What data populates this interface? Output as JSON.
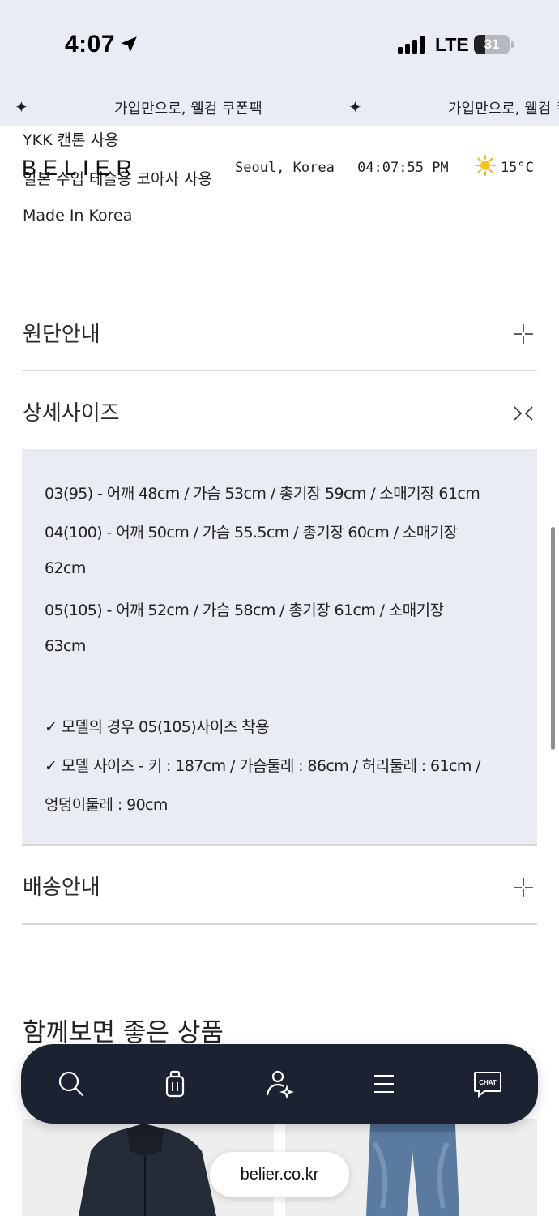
{
  "status_bar": {
    "time": "4:07",
    "network": "LTE",
    "battery": "31",
    "battery_level": 0.31
  },
  "banner": {
    "text": "가입만으로, 웰컴 쿠폰팩",
    "text_partial": "가입만으로, 웰컴 쿠",
    "star": "✦"
  },
  "header": {
    "logo": "BELIER",
    "location": "Seoul, Korea",
    "clock": "04:07:55 PM",
    "weather_icon": "sun-icon",
    "temperature": "15°C"
  },
  "spec_lines": [
    "YKK 캔톤 사용",
    "일본 수입 테슬용 코아사 사용",
    "Made In Korea"
  ],
  "accordion": {
    "fabric_title": "원단안내",
    "size_title": "상세사이즈",
    "shipping_title": "배송안내",
    "size_lines": [
      "03(95) - 어깨 48cm / 가슴 53cm / 총기장 59cm / 소매기장 61cm",
      "04(100) - 어깨 50cm / 가슴 55.5cm / 총기장 60cm / 소매기장",
      "62cm",
      "05(105) - 어깨 52cm / 가슴 58cm / 총기장 61cm / 소매기장",
      "63cm",
      "✓ 모델의 경우 05(105)사이즈 착용",
      "✓ 모델 사이즈 - 키 : 187cm / 가슴둘레 : 86cm / 허리둘레 : 61cm /",
      "엉덩이둘레 : 90cm"
    ]
  },
  "recommend": {
    "title": "함께보면 좋은 상품"
  },
  "bottom_nav": {
    "items": [
      "search-icon",
      "shopping-bag-icon",
      "account-icon",
      "menu-icon",
      "chat-icon"
    ],
    "chat_label": "CHAT"
  },
  "url": "belier.co.kr"
}
